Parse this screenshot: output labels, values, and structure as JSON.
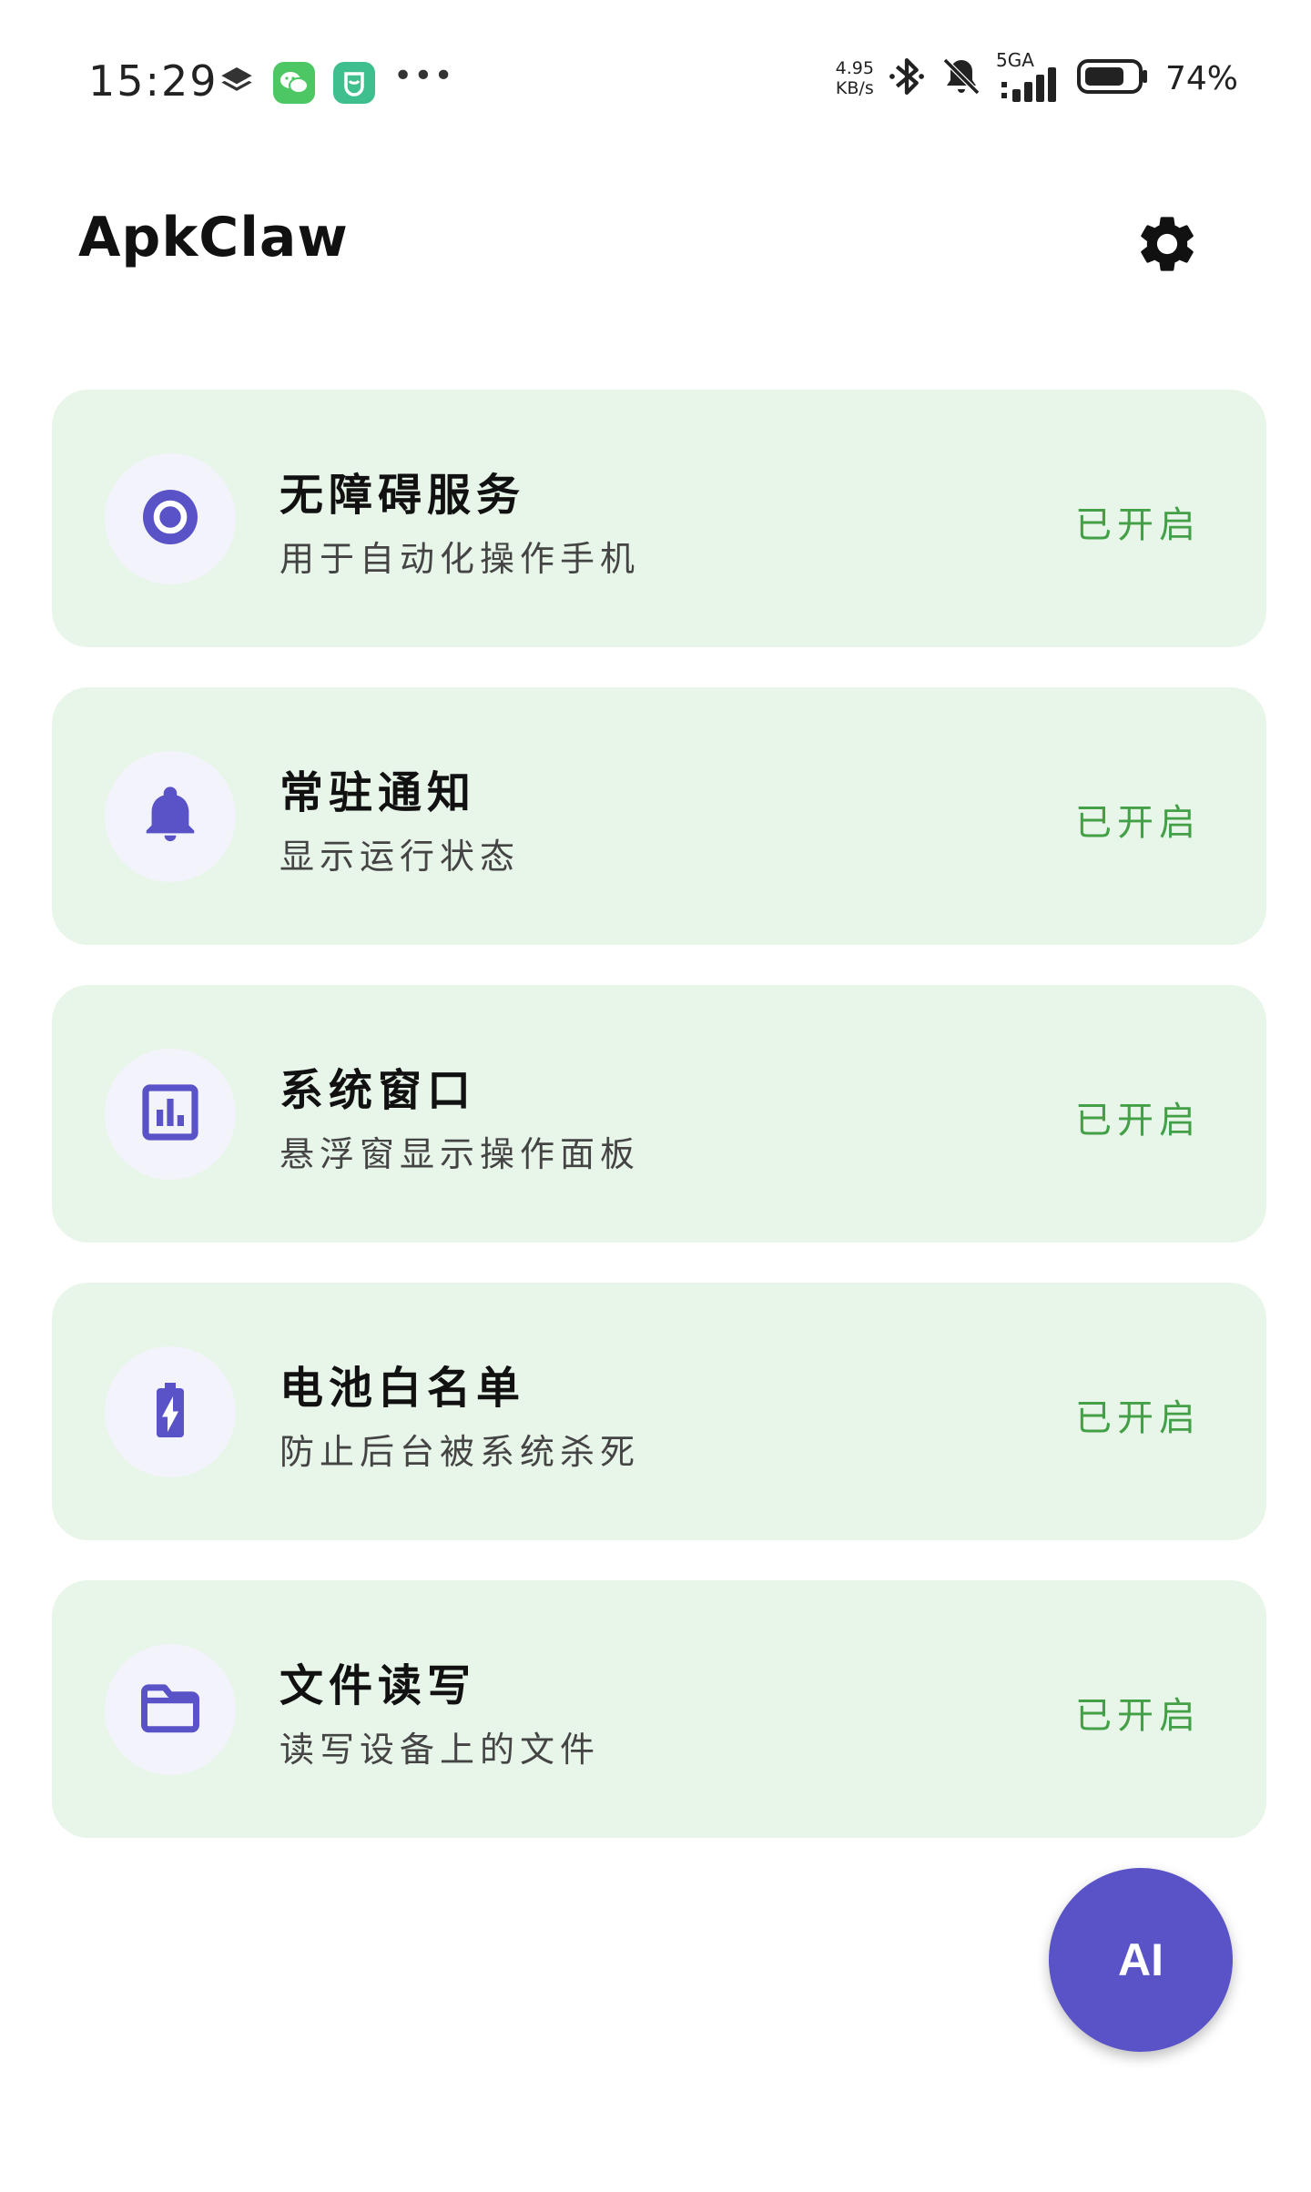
{
  "status_bar": {
    "time": "15:29",
    "net_speed_value": "4.95",
    "net_speed_unit": "KB/s",
    "network_label": "5GA",
    "battery_percent": "74%"
  },
  "header": {
    "title": "ApkClaw"
  },
  "cards": [
    {
      "title": "无障碍服务",
      "description": "用于自动化操作手机",
      "status": "已开启",
      "icon": "radio-target-icon"
    },
    {
      "title": "常驻通知",
      "description": "显示运行状态",
      "status": "已开启",
      "icon": "bell-icon"
    },
    {
      "title": "系统窗口",
      "description": "悬浮窗显示操作面板",
      "status": "已开启",
      "icon": "bar-chart-icon"
    },
    {
      "title": "电池白名单",
      "description": "防止后台被系统杀死",
      "status": "已开启",
      "icon": "battery-charging-icon"
    },
    {
      "title": "文件读写",
      "description": "读写设备上的文件",
      "status": "已开启",
      "icon": "folder-icon"
    }
  ],
  "fab": {
    "label": "AI"
  },
  "colors": {
    "accent": "#5a52c7",
    "card_bg": "#e8f5e9",
    "status_green": "#43a047",
    "icon_circle": "#f3f3fb"
  }
}
